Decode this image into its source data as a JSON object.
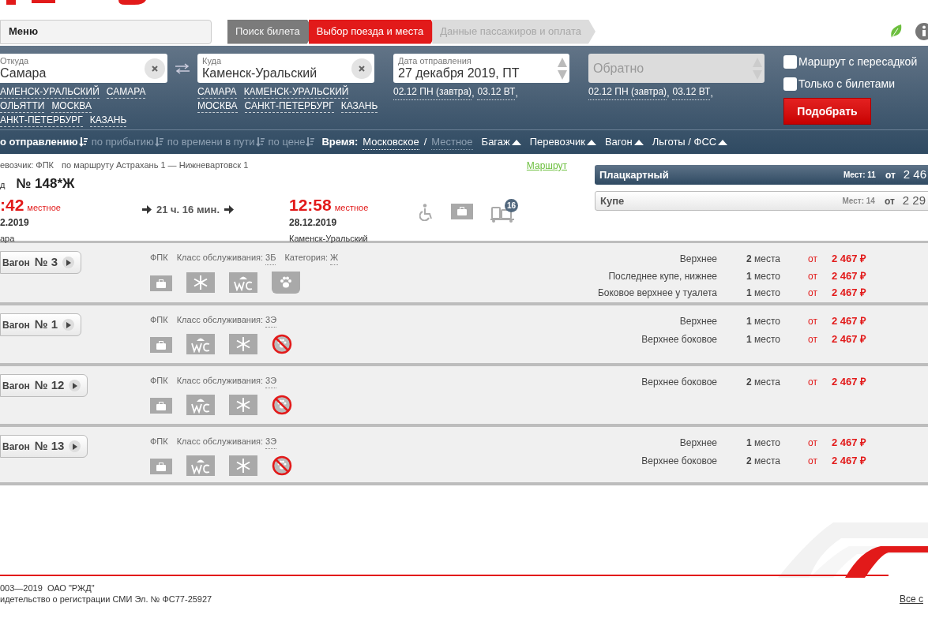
{
  "header": {
    "menu_label": "Меню",
    "steps": [
      {
        "label": "Поиск билета",
        "selected": false,
        "completed": true
      },
      {
        "label": "Выбор поезда и места",
        "selected": true,
        "completed": false
      },
      {
        "label": "Данные пассажиров и оплата",
        "selected": false,
        "completed": false
      }
    ]
  },
  "search": {
    "from": {
      "label": "Откуда",
      "value": "Самара",
      "suggestions": [
        [
          "АМЕНСК-УРАЛЬСКИЙ",
          "САМАРА"
        ],
        [
          "ОЛЬЯТТИ",
          "МОСКВА"
        ],
        [
          "АНКТ-ПЕТЕРБУРГ",
          "КАЗАНЬ"
        ]
      ]
    },
    "to": {
      "label": "Куда",
      "value": "Каменск-Уральский",
      "suggestions": [
        [
          "САМАРА",
          "КАМЕНСК-УРАЛЬСКИЙ"
        ],
        [
          "МОСКВА",
          "САНКТ-ПЕТЕРБУРГ",
          "КАЗАНЬ"
        ]
      ]
    },
    "date": {
      "label": "Дата отправления",
      "value": "27 декабря 2019, ПТ",
      "quick": [
        "02.12 ПН (завтра)",
        "03.12 ВТ"
      ],
      "separator": ","
    },
    "return": {
      "placeholder": "Обратно",
      "quick": [
        "02.12 ПН (завтра)",
        "03.12 ВТ"
      ],
      "separator": ","
    },
    "options": [
      {
        "label": "Маршрут с пересадкой",
        "checked": false
      },
      {
        "label": "Только с билетами",
        "checked": false
      }
    ],
    "submit": "Подобрать"
  },
  "sortbar": {
    "sorts": [
      {
        "label": "о отправлению",
        "selected": true
      },
      {
        "label": "по прибытию",
        "selected": false
      },
      {
        "label": "по времени в пути",
        "selected": false
      },
      {
        "label": "по цене",
        "selected": false
      }
    ],
    "time_label": "Время:",
    "time_separator": "/",
    "time_options": [
      {
        "label": "Московское",
        "selected": true
      },
      {
        "label": "Местное",
        "selected": false
      }
    ],
    "filters": [
      "Багаж",
      "Перевозчик",
      "Вагон",
      "Льготы / ФСС"
    ]
  },
  "train": {
    "carrier": "евозчик: ФПК",
    "route": "по маршруту Астрахань 1 — Нижневартовск 1",
    "route_link": "Маршрут",
    "number_label": "д",
    "number": "№ 148*Ж",
    "departure": {
      "time": ":42",
      "note": "местное",
      "date": "2.2019",
      "station": "ара"
    },
    "duration": "21 ч. 16 мин.",
    "arrival": {
      "time": "12:58",
      "note": "местное",
      "date": "28.12.2019",
      "station": "Каменск-Уральский"
    },
    "badge": "16",
    "classes": [
      {
        "name": "Плацкартный",
        "seats": "Мест: 11",
        "from": "от",
        "price": "2 46",
        "selected": true
      },
      {
        "name": "Купе",
        "seats": "Мест: 14",
        "from": "от",
        "price": "2 29",
        "selected": false
      }
    ]
  },
  "cars": [
    {
      "label": "Вагон",
      "number": "№ 3",
      "carrier": "ФПК",
      "service_label": "Класс обслуживания:",
      "service": "3Б",
      "category_label": "Категория:",
      "category": "Ж",
      "amenities": [
        {
          "kind": "bag"
        },
        {
          "kind": "snow"
        },
        {
          "kind": "wc"
        },
        {
          "kind": "pets"
        }
      ],
      "seats": [
        {
          "type": "Верхнее",
          "count": "2",
          "unit": "места",
          "from": "от",
          "price": "2 467 ₽"
        },
        {
          "type": "Последнее купе, нижнее",
          "count": "1",
          "unit": "место",
          "from": "от",
          "price": "2 467 ₽"
        },
        {
          "type": "Боковое верхнее у туалета",
          "count": "1",
          "unit": "место",
          "from": "от",
          "price": "2 467 ₽"
        }
      ]
    },
    {
      "label": "Вагон",
      "number": "№ 1",
      "carrier": "ФПК",
      "service_label": "Класс обслуживания:",
      "service": "3Э",
      "amenities": [
        {
          "kind": "bag"
        },
        {
          "kind": "wc"
        },
        {
          "kind": "snow"
        },
        {
          "kind": "no_pets"
        }
      ],
      "seats": [
        {
          "type": "Верхнее",
          "count": "1",
          "unit": "место",
          "from": "от",
          "price": "2 467 ₽"
        },
        {
          "type": "Верхнее боковое",
          "count": "1",
          "unit": "место",
          "from": "от",
          "price": "2 467 ₽"
        }
      ]
    },
    {
      "label": "Вагон",
      "number": "№ 12",
      "carrier": "ФПК",
      "service_label": "Класс обслуживания:",
      "service": "3Э",
      "amenities": [
        {
          "kind": "bag"
        },
        {
          "kind": "wc"
        },
        {
          "kind": "snow"
        },
        {
          "kind": "no_pets"
        }
      ],
      "seats": [
        {
          "type": "Верхнее боковое",
          "count": "2",
          "unit": "места",
          "from": "от",
          "price": "2 467 ₽"
        }
      ]
    },
    {
      "label": "Вагон",
      "number": "№ 13",
      "carrier": "ФПК",
      "service_label": "Класс обслуживания:",
      "service": "3Э",
      "amenities": [
        {
          "kind": "bag"
        },
        {
          "kind": "wc"
        },
        {
          "kind": "snow"
        },
        {
          "kind": "no_pets"
        }
      ],
      "seats": [
        {
          "type": "Верхнее",
          "count": "1",
          "unit": "место",
          "from": "от",
          "price": "2 467 ₽"
        },
        {
          "type": "Верхнее боковое",
          "count": "2",
          "unit": "места",
          "from": "от",
          "price": "2 467 ₽"
        }
      ]
    }
  ],
  "footer": {
    "lines": [
      "003—2019  ОАО \"РЖД\"",
      "идетельство о регистрации СМИ Эл. № ФС77-25927"
    ],
    "link": "Все с"
  }
}
